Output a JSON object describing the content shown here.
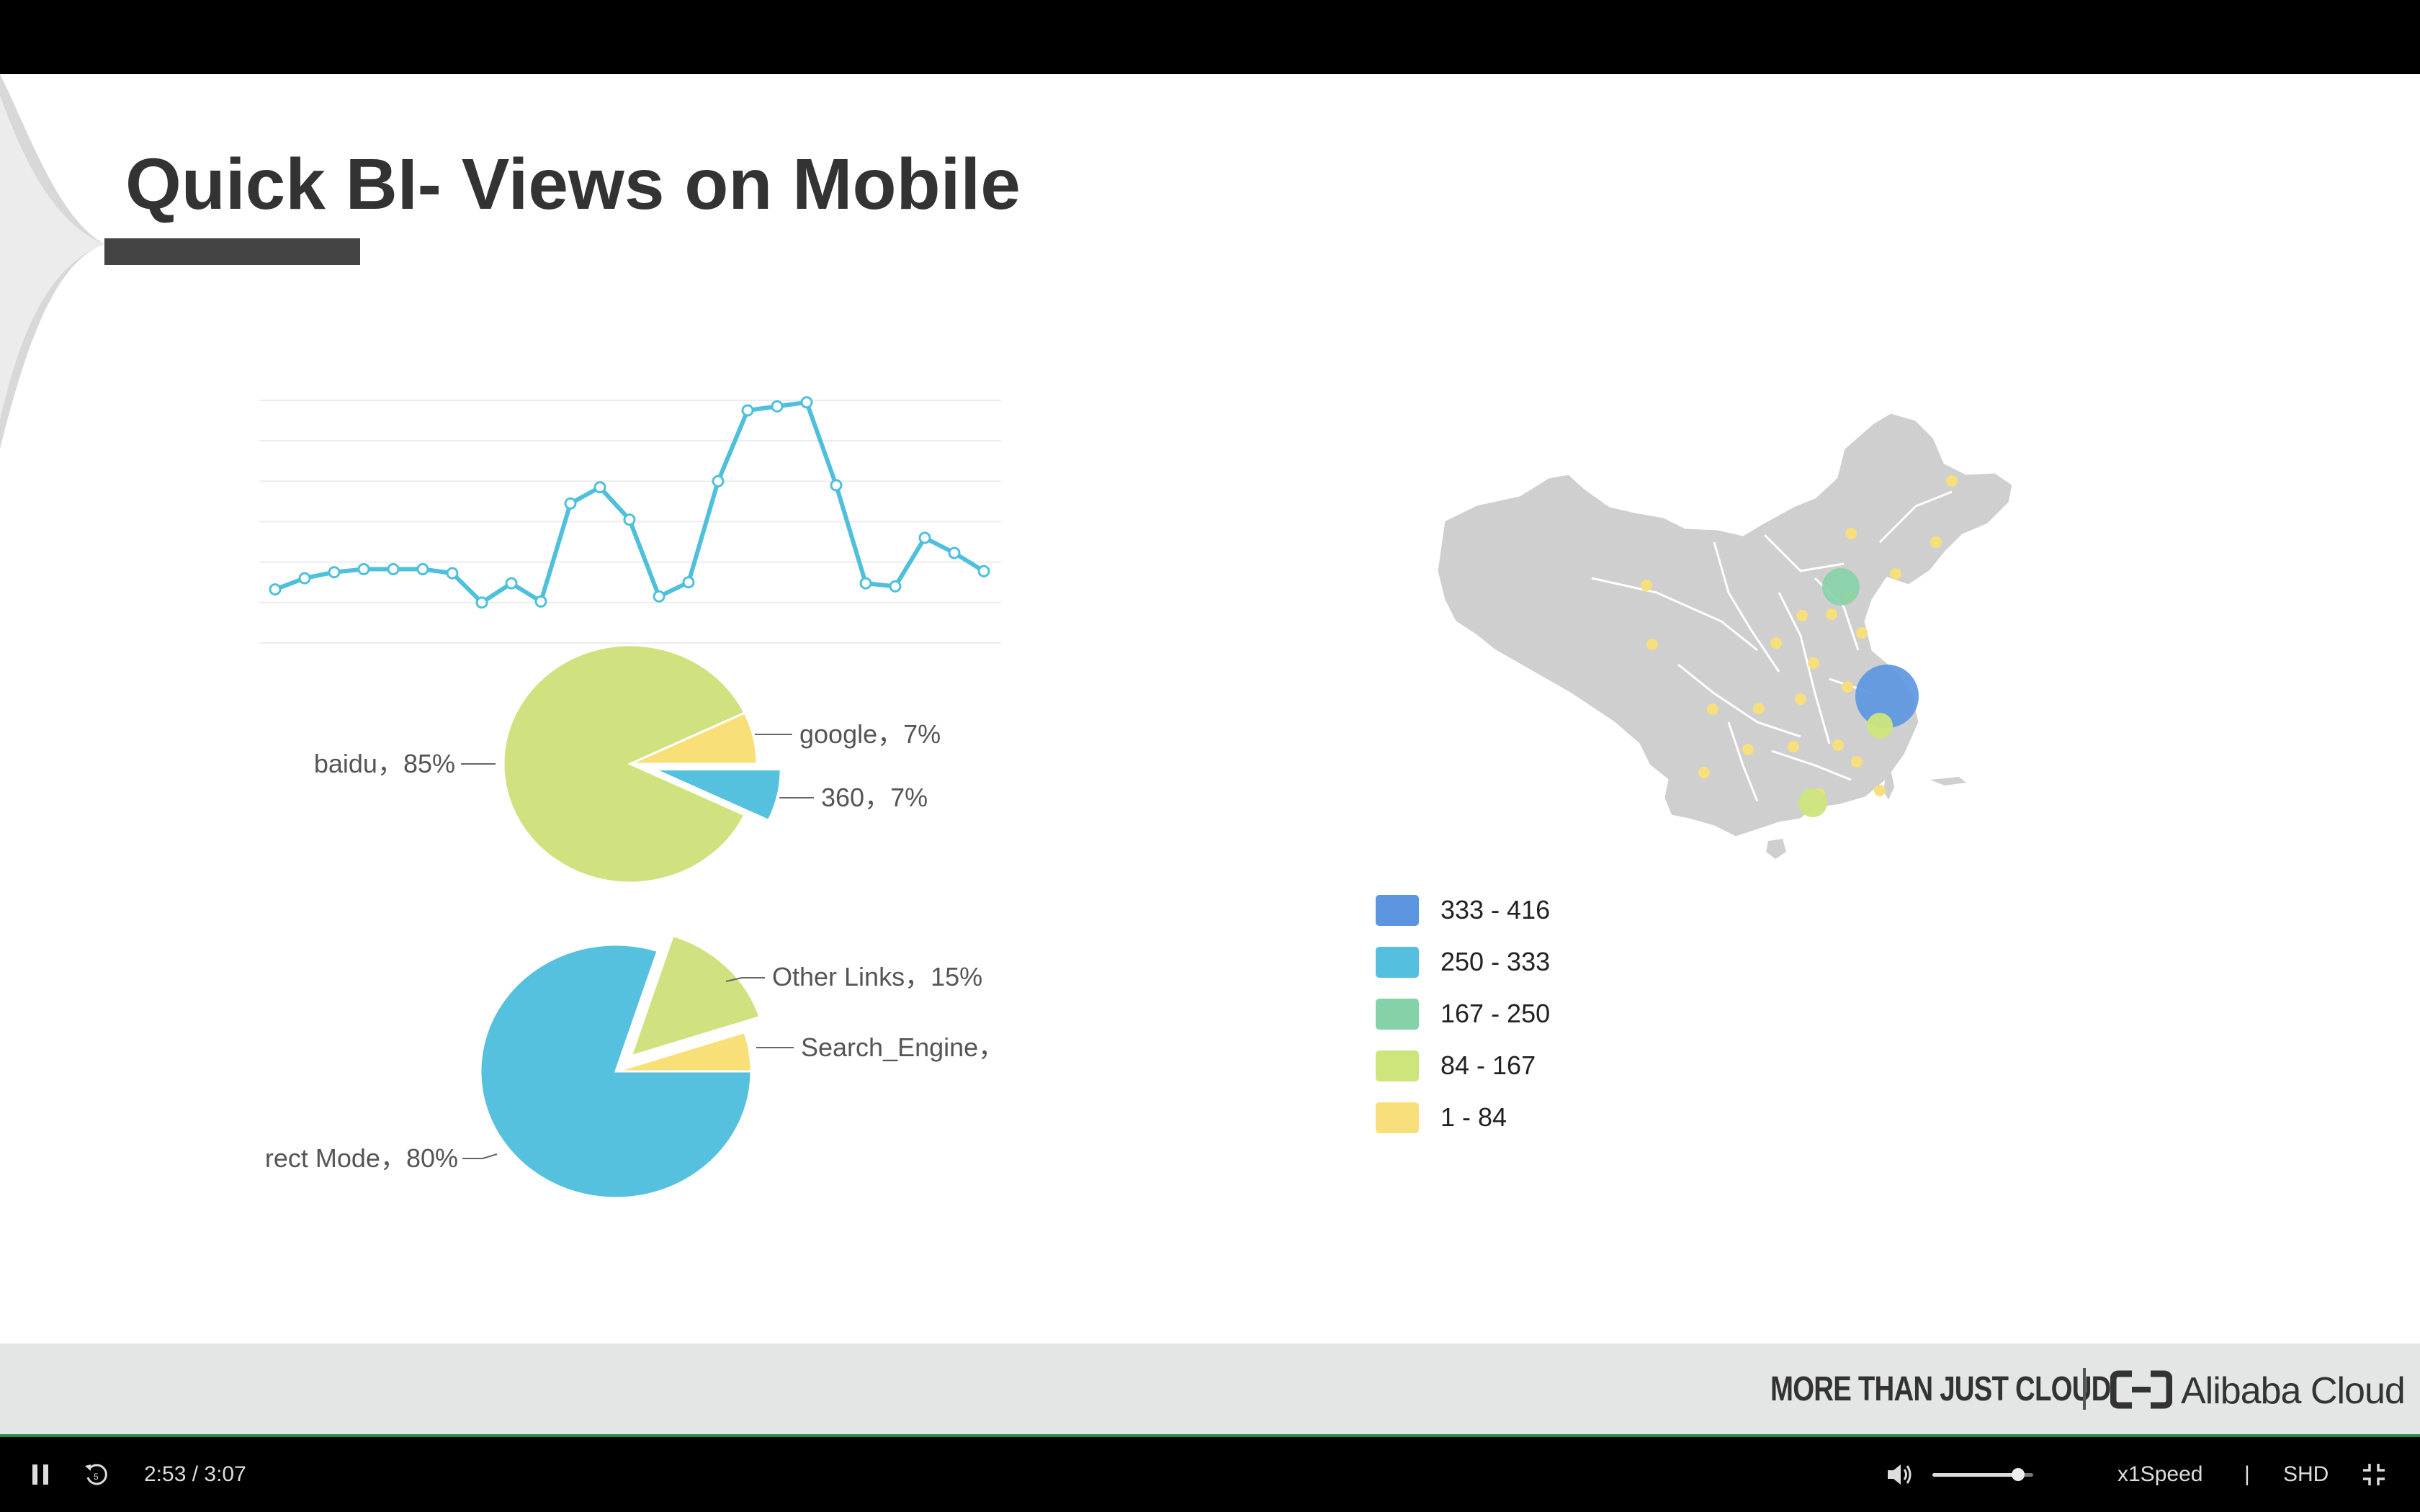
{
  "slide": {
    "title": "Quick BI- Views on Mobile",
    "brand": {
      "tagline": "MORE THAN JUST CLOUD",
      "company": "Alibaba Cloud"
    }
  },
  "charts": {
    "line": {
      "type": "line",
      "values": [
        53,
        64,
        70,
        73,
        73,
        73,
        69,
        40,
        59,
        41,
        138,
        154,
        122,
        46,
        60,
        160,
        230,
        234,
        238,
        156,
        59,
        56,
        104,
        89,
        71
      ],
      "color": "#4ec0db"
    },
    "pie1": {
      "type": "pie",
      "slices": [
        {
          "name": "baidu",
          "value": 85,
          "label": "baidu，85%",
          "color": "#cfe27f"
        },
        {
          "name": "360",
          "value": 7,
          "label": "360，7%",
          "color": "#56c1de"
        },
        {
          "name": "google",
          "value": 7,
          "label": "google，7%",
          "color": "#f9df78"
        }
      ]
    },
    "pie2": {
      "type": "pie",
      "slices": [
        {
          "name": "Direct Mode",
          "value": 80,
          "label": "rect Mode，80%",
          "color": "#56c1de"
        },
        {
          "name": "Other Links",
          "value": 15,
          "label": "Other Links，15%",
          "color": "#cfe27f"
        },
        {
          "name": "Search_Engine",
          "value": 5,
          "label": "Search_Engine，",
          "color": "#f9df78"
        }
      ]
    },
    "map": {
      "type": "bubble-map",
      "legend": [
        {
          "label": "333 - 416",
          "color": "#5b95e0"
        },
        {
          "label": "250 - 333",
          "color": "#55bfe0"
        },
        {
          "label": "167 - 250",
          "color": "#86d2a8"
        },
        {
          "label": "84 - 167",
          "color": "#cde57b"
        },
        {
          "label": "1 - 84",
          "color": "#f7df7b"
        }
      ]
    }
  },
  "player": {
    "time": "2:53 / 3:07",
    "speed": "x1Speed",
    "quality": "SHD",
    "divider": "|",
    "volume": 0.85
  }
}
